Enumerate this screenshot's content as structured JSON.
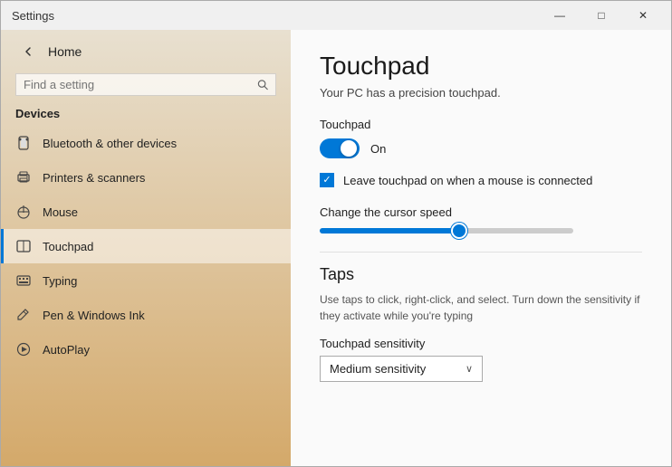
{
  "window": {
    "title": "Settings",
    "controls": {
      "minimize": "—",
      "maximize": "□",
      "close": "✕"
    }
  },
  "sidebar": {
    "back_button": "←",
    "search": {
      "placeholder": "Find a setting",
      "value": ""
    },
    "section_title": "Devices",
    "items": [
      {
        "id": "bluetooth",
        "label": "Bluetooth & other devices",
        "active": false
      },
      {
        "id": "printers",
        "label": "Printers & scanners",
        "active": false
      },
      {
        "id": "mouse",
        "label": "Mouse",
        "active": false
      },
      {
        "id": "touchpad",
        "label": "Touchpad",
        "active": true
      },
      {
        "id": "typing",
        "label": "Typing",
        "active": false
      },
      {
        "id": "pen",
        "label": "Pen & Windows Ink",
        "active": false
      },
      {
        "id": "autoplay",
        "label": "AutoPlay",
        "active": false
      }
    ]
  },
  "content": {
    "page_title": "Touchpad",
    "subtitle": "Your PC has a precision touchpad.",
    "touchpad_section_label": "Touchpad",
    "toggle_on_label": "On",
    "toggle_state": true,
    "checkbox_label": "Leave touchpad on when a mouse is connected",
    "checkbox_checked": true,
    "slider_label": "Change the cursor speed",
    "taps_title": "Taps",
    "taps_desc": "Use taps to click, right-click, and select. Turn down the sensitivity if they activate while you're typing",
    "sensitivity_label": "Touchpad sensitivity",
    "sensitivity_value": "Medium sensitivity",
    "dropdown_chevron": "∨"
  }
}
